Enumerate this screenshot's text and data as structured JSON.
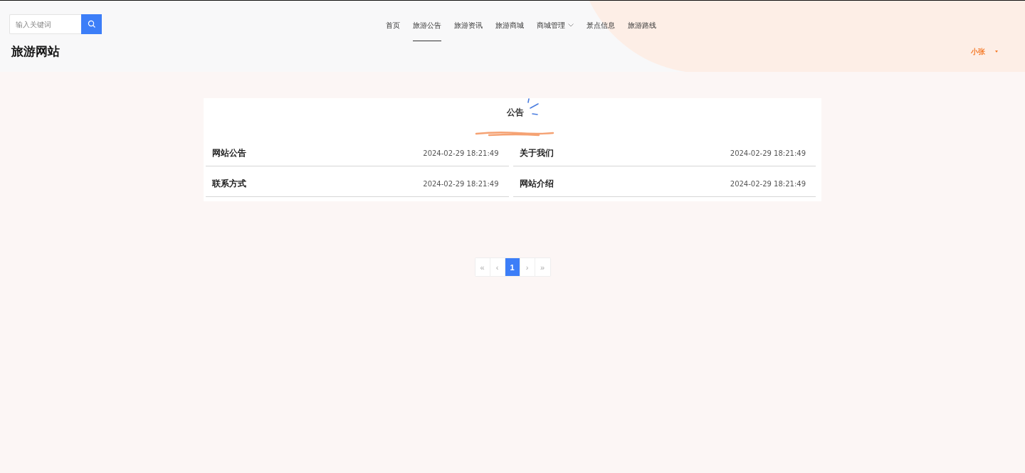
{
  "header": {
    "search": {
      "placeholder": "输入关键词"
    },
    "site_title": "旅游网站",
    "user": {
      "name": "小张"
    }
  },
  "nav": [
    {
      "label": "首页",
      "selected": false,
      "dropdown": false
    },
    {
      "label": "旅游公告",
      "selected": true,
      "dropdown": false
    },
    {
      "label": "旅游资讯",
      "selected": false,
      "dropdown": false
    },
    {
      "label": "旅游商城",
      "selected": false,
      "dropdown": false
    },
    {
      "label": "商城管理",
      "selected": false,
      "dropdown": true
    },
    {
      "label": "景点信息",
      "selected": false,
      "dropdown": false
    },
    {
      "label": "旅游路线",
      "selected": false,
      "dropdown": false
    }
  ],
  "notices": {
    "title": "公告",
    "items": [
      {
        "title": "网站公告",
        "time": "2024-02-29 18:21:49"
      },
      {
        "title": "关于我们",
        "time": "2024-02-29 18:21:49"
      },
      {
        "title": "联系方式",
        "time": "2024-02-29 18:21:49"
      },
      {
        "title": "网站介绍",
        "time": "2024-02-29 18:21:49"
      }
    ]
  },
  "pagination": [
    {
      "label": "«",
      "selected": false
    },
    {
      "label": "‹",
      "selected": false
    },
    {
      "label": "1",
      "selected": true
    },
    {
      "label": "›",
      "selected": false
    },
    {
      "label": "»",
      "selected": false
    }
  ]
}
